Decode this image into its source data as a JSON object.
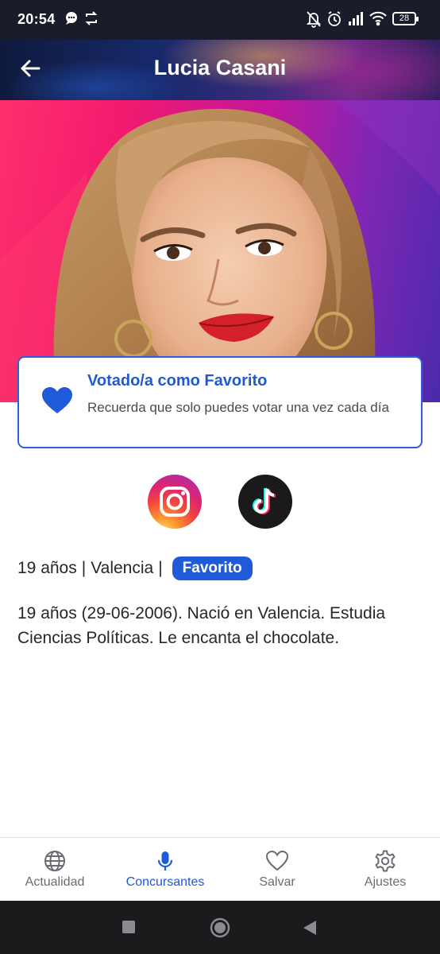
{
  "status_bar": {
    "time": "20:54",
    "battery": "28",
    "icons": [
      "chat-bubble-icon",
      "sync-icon",
      "bell-off-icon",
      "alarm-icon",
      "signal-icon",
      "wifi-icon",
      "battery-icon"
    ]
  },
  "header": {
    "title": "Lucia Casani",
    "back_icon": "arrow-left-icon"
  },
  "favorite_card": {
    "title": "Votado/a como Favorito",
    "subtitle": "Recuerda que solo puedes votar una vez cada día",
    "icon": "heart-filled-icon"
  },
  "social": {
    "icons": [
      "instagram-icon",
      "tiktok-icon"
    ]
  },
  "info": {
    "age": "19 años",
    "separator": "|",
    "city": "Valencia",
    "badge": "Favorito"
  },
  "bio": "19 años (29-06-2006). Nació en Valencia. Estudia Ciencias Políticas. Le encanta el chocolate.",
  "bottom_nav": {
    "items": [
      {
        "label": "Actualidad",
        "icon": "globe-icon",
        "active": false
      },
      {
        "label": "Concursantes",
        "icon": "microphone-icon",
        "active": true
      },
      {
        "label": "Salvar",
        "icon": "heart-outline-icon",
        "active": false
      },
      {
        "label": "Ajustes",
        "icon": "gear-icon",
        "active": false
      }
    ]
  },
  "colors": {
    "accent": "#1f5bd9",
    "status_bar": "#1b1c2a",
    "system_nav": "#1b1b1d",
    "inactive_nav": "#6b6b73"
  }
}
